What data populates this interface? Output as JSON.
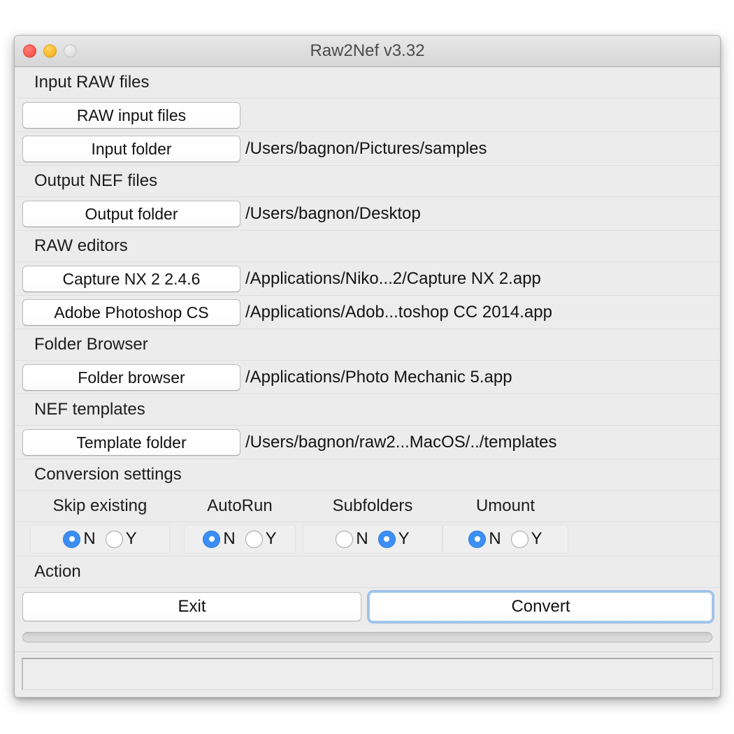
{
  "window": {
    "title": "Raw2Nef v3.32",
    "traffic_lights": [
      {
        "name": "close",
        "color": "#fa5e56",
        "enabled": true
      },
      {
        "name": "minimize",
        "color": "#fdbd2e",
        "enabled": true
      },
      {
        "name": "zoom",
        "color": "#e2e2e2",
        "enabled": false
      }
    ]
  },
  "sections": {
    "input_raw_files": {
      "label": "Input RAW files",
      "raw_input_files_button": "RAW input files",
      "raw_input_files_path": "",
      "input_folder_button": "Input folder",
      "input_folder_path": "/Users/bagnon/Pictures/samples"
    },
    "output_nef_files": {
      "label": "Output NEF files",
      "output_folder_button": "Output folder",
      "output_folder_path": "/Users/bagnon/Desktop"
    },
    "raw_editors": {
      "label": "RAW editors",
      "capture_nx_button": "Capture NX 2 2.4.6",
      "capture_nx_path": "/Applications/Niko...2/Capture NX 2.app",
      "photoshop_button": "Adobe Photoshop CS",
      "photoshop_path": "/Applications/Adob...toshop CC 2014.app"
    },
    "folder_browser": {
      "label": "Folder Browser",
      "folder_browser_button": "Folder browser",
      "folder_browser_path": "/Applications/Photo Mechanic 5.app"
    },
    "nef_templates": {
      "label": "NEF templates",
      "template_folder_button": "Template folder",
      "template_folder_path": "/Users/bagnon/raw2...MacOS/../templates"
    },
    "conversion_settings": {
      "label": "Conversion settings",
      "options": [
        {
          "name": "skip-existing",
          "label": "Skip existing",
          "selected": "N",
          "choices": [
            "N",
            "Y"
          ]
        },
        {
          "name": "autorun",
          "label": "AutoRun",
          "selected": "N",
          "choices": [
            "N",
            "Y"
          ]
        },
        {
          "name": "subfolders",
          "label": "Subfolders",
          "selected": "Y",
          "choices": [
            "N",
            "Y"
          ]
        },
        {
          "name": "umount",
          "label": "Umount",
          "selected": "N",
          "choices": [
            "N",
            "Y"
          ]
        }
      ]
    },
    "action": {
      "label": "Action",
      "exit_button": "Exit",
      "convert_button": "Convert",
      "convert_focused": true
    }
  },
  "progress": {
    "value": 0,
    "max": 100
  },
  "status": {
    "text": ""
  },
  "colors": {
    "accent_blue": "#3b8ef3",
    "focus_ring": "#7db2e9",
    "window_bg": "#ececec",
    "titlebar_bg": "#dcdcdc"
  }
}
